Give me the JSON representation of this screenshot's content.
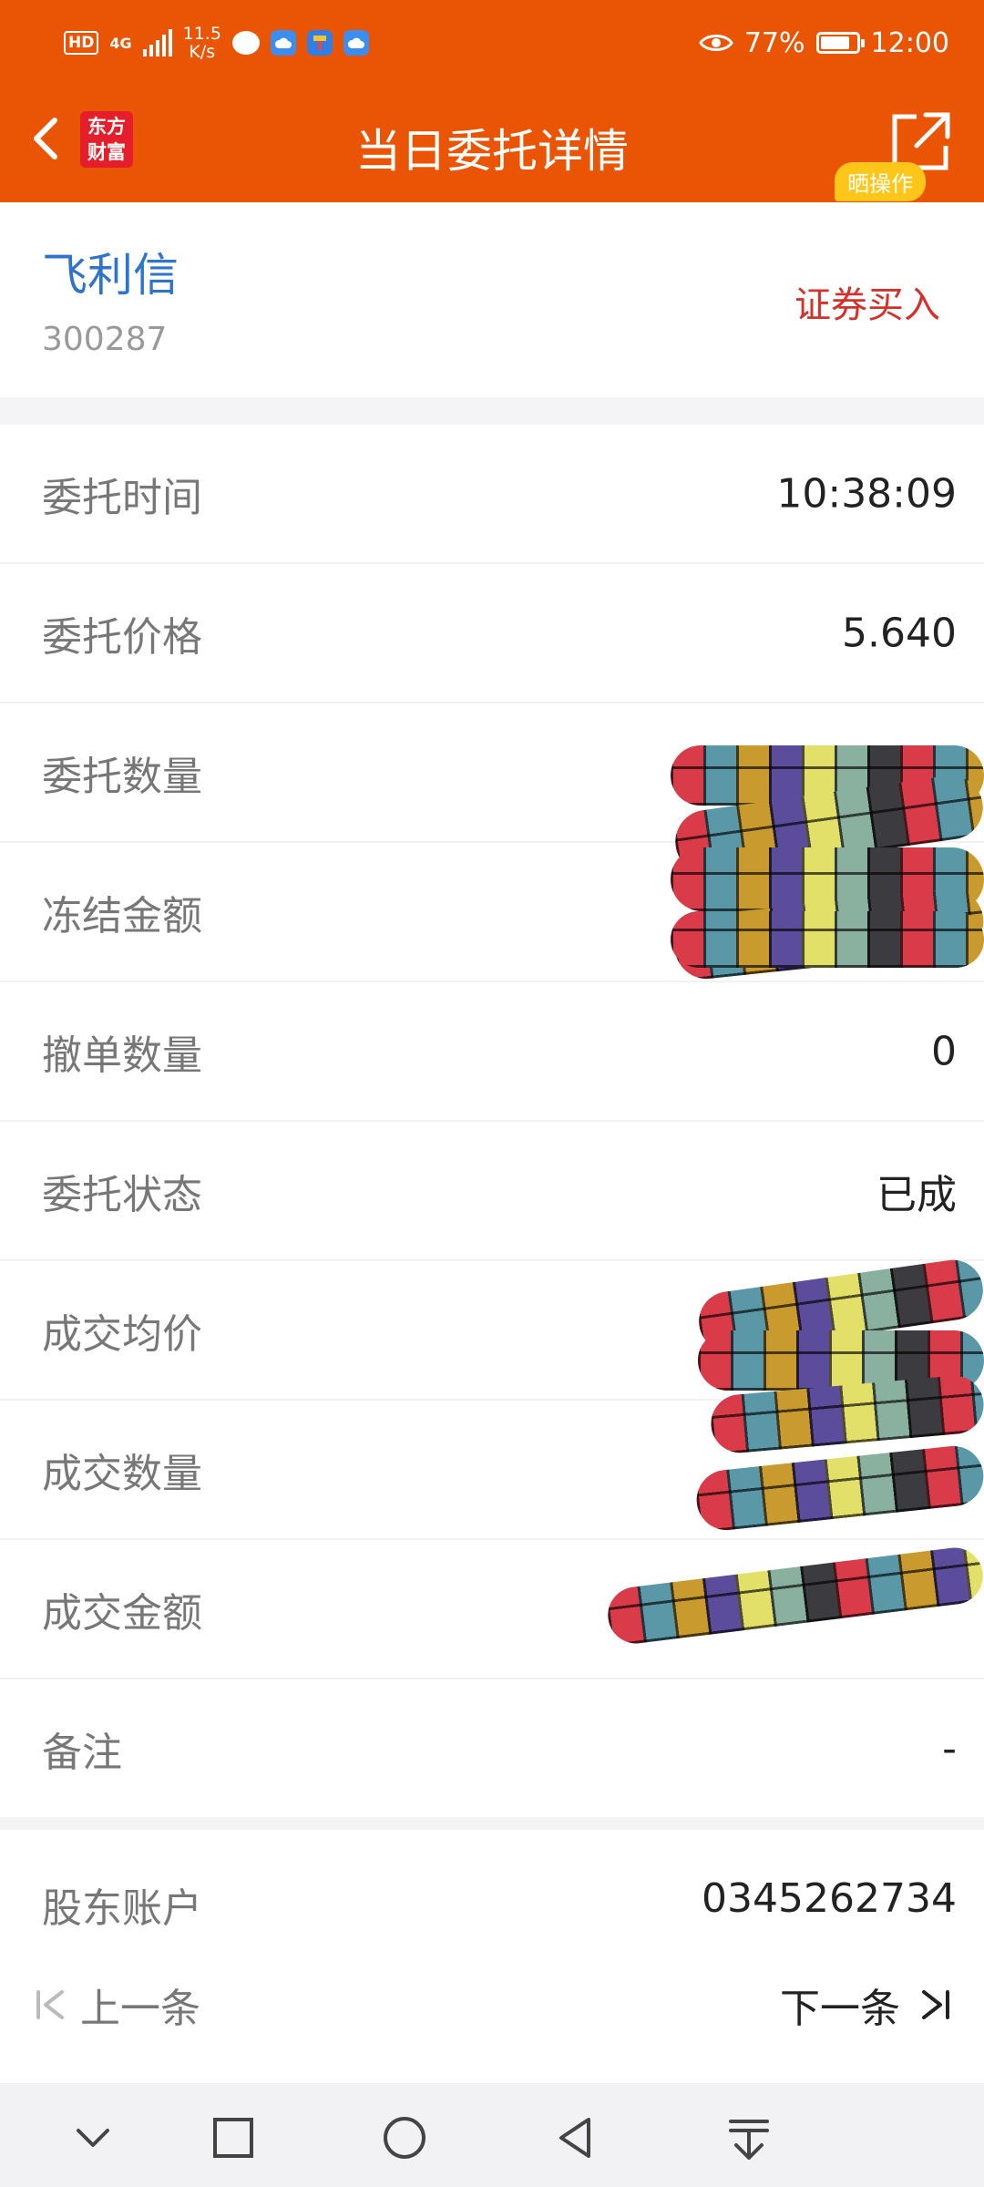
{
  "status_bar": {
    "hd": "HD",
    "network": "4G",
    "speed_value": "11.5",
    "speed_unit": "K/s",
    "battery": "77%",
    "time": "12:00"
  },
  "header": {
    "logo_line1": "东方",
    "logo_line2": "财富",
    "title": "当日委托详情",
    "share_badge": "晒操作",
    "color": "#e95504"
  },
  "stock": {
    "name": "飞利信",
    "code": "300287",
    "trade_type": "证券买入"
  },
  "details": {
    "rows": [
      {
        "label": "委托时间",
        "value": "10:38:09"
      },
      {
        "label": "委托价格",
        "value": "5.640"
      },
      {
        "label": "委托数量",
        "value": ""
      },
      {
        "label": "冻结金额",
        "value": ""
      },
      {
        "label": "撤单数量",
        "value": "0"
      },
      {
        "label": "委托状态",
        "value": "已成"
      },
      {
        "label": "成交均价",
        "value": ""
      },
      {
        "label": "成交数量",
        "value": ""
      },
      {
        "label": "成交金额",
        "value": ""
      },
      {
        "label": "备注",
        "value": "-"
      }
    ]
  },
  "account": {
    "label": "股东账户",
    "value": "0345262734"
  },
  "pager": {
    "prev": "上一条",
    "next": "下一条"
  }
}
